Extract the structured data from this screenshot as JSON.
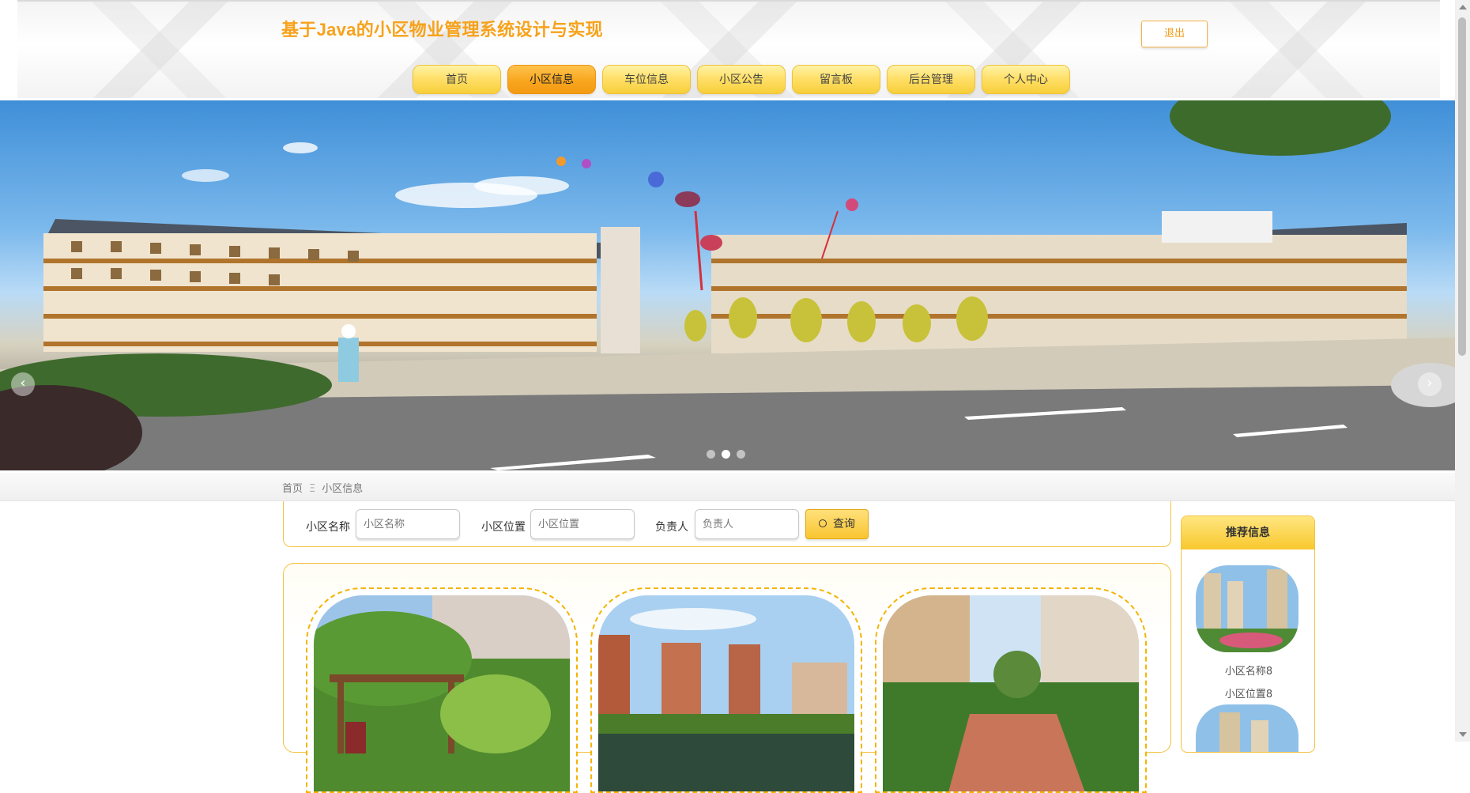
{
  "header": {
    "site_title": "基于Java的小区物业管理系统设计与实现",
    "logout_label": "退出"
  },
  "nav": {
    "items": [
      {
        "label": "首页",
        "active": false
      },
      {
        "label": "小区信息",
        "active": true
      },
      {
        "label": "车位信息",
        "active": false
      },
      {
        "label": "小区公告",
        "active": false
      },
      {
        "label": "留言板",
        "active": false
      },
      {
        "label": "后台管理",
        "active": false
      },
      {
        "label": "个人中心",
        "active": false
      }
    ]
  },
  "banner": {
    "slide_count": 3,
    "active_slide": 2
  },
  "breadcrumb": {
    "home": "首页",
    "separator": "Ξ",
    "current": "小区信息"
  },
  "search": {
    "name_label": "小区名称",
    "name_placeholder": "小区名称",
    "location_label": "小区位置",
    "location_placeholder": "小区位置",
    "manager_label": "负责人",
    "manager_placeholder": "负责人",
    "button_label": "查询"
  },
  "recommend": {
    "title": "推荐信息",
    "items": [
      {
        "name": "小区名称8",
        "location": "小区位置8"
      }
    ]
  },
  "colors": {
    "accent": "#f7a21b",
    "nav_yellow": "#ffe06a",
    "nav_active": "#f8a61e",
    "border_yellow": "#f3c23f"
  }
}
